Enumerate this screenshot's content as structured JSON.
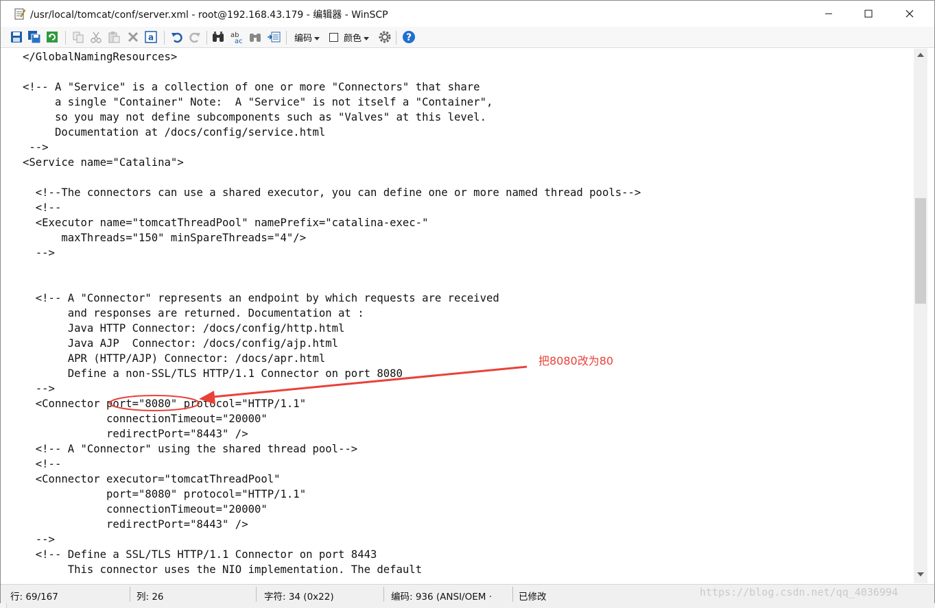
{
  "window": {
    "title": "/usr/local/tomcat/conf/server.xml - root@192.168.43.179 - 编辑器 - WinSCP"
  },
  "toolbar": {
    "encoding_label": "编码",
    "color_label": "颜色",
    "icons": [
      "save-icon",
      "save-all-icon",
      "reload-icon",
      "copy-icon",
      "cut-icon",
      "paste-icon",
      "delete-icon",
      "select-all-icon",
      "undo-icon",
      "redo-icon",
      "find-icon",
      "replace-icon",
      "find-next-icon",
      "goto-line-icon",
      "settings-icon",
      "help-icon"
    ]
  },
  "editor": {
    "lines": [
      "</GlobalNamingResources>",
      "",
      "<!-- A \"Service\" is a collection of one or more \"Connectors\" that share",
      "     a single \"Container\" Note:  A \"Service\" is not itself a \"Container\",",
      "     so you may not define subcomponents such as \"Valves\" at this level.",
      "     Documentation at /docs/config/service.html",
      " -->",
      "<Service name=\"Catalina\">",
      "",
      "  <!--The connectors can use a shared executor, you can define one or more named thread pools-->",
      "  <!--",
      "  <Executor name=\"tomcatThreadPool\" namePrefix=\"catalina-exec-\"",
      "      maxThreads=\"150\" minSpareThreads=\"4\"/>",
      "  -->",
      "",
      "",
      "  <!-- A \"Connector\" represents an endpoint by which requests are received",
      "       and responses are returned. Documentation at :",
      "       Java HTTP Connector: /docs/config/http.html",
      "       Java AJP  Connector: /docs/config/ajp.html",
      "       APR (HTTP/AJP) Connector: /docs/apr.html",
      "       Define a non-SSL/TLS HTTP/1.1 Connector on port 8080",
      "  -->",
      "  <Connector port=\"8080\" protocol=\"HTTP/1.1\"",
      "             connectionTimeout=\"20000\"",
      "             redirectPort=\"8443\" />",
      "  <!-- A \"Connector\" using the shared thread pool-->",
      "  <!--",
      "  <Connector executor=\"tomcatThreadPool\"",
      "             port=\"8080\" protocol=\"HTTP/1.1\"",
      "             connectionTimeout=\"20000\"",
      "             redirectPort=\"8443\" />",
      "  -->",
      "  <!-- Define a SSL/TLS HTTP/1.1 Connector on port 8443",
      "       This connector uses the NIO implementation. The default"
    ]
  },
  "annotation": {
    "text": "把8080改为80",
    "color": "#e8413a"
  },
  "statusbar": {
    "line": "行: 69/167",
    "column": "列: 26",
    "character": "字符: 34 (0x22)",
    "encoding": "编码: 936  (ANSI/OEM ·",
    "modified": "已修改"
  },
  "watermark": "https://blog.csdn.net/qq_4036994"
}
